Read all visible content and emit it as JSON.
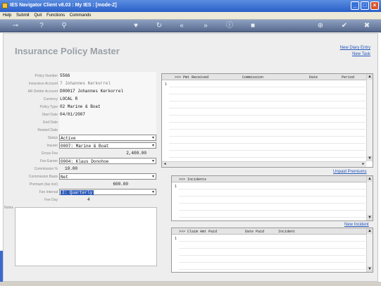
{
  "window": {
    "title": "IES Navigator Client v8.03 : My IES :      [mode-Z]"
  },
  "menu": [
    "Help",
    "Submit",
    "Quit",
    "Functions",
    "Commands"
  ],
  "toolbar_icons": [
    "key-icon",
    "help-icon",
    "search-icon",
    "heart-icon",
    "refresh-icon",
    "rewind-icon",
    "fast-forward-icon",
    "info-icon",
    "stop-icon",
    "add-icon",
    "check-icon",
    "close-icon"
  ],
  "page": {
    "title": "Insurance Policy Master",
    "links": {
      "new_diary": "New Diary Entry",
      "new_task": "New Task"
    }
  },
  "form": {
    "policy_number": {
      "label": "Policy Number",
      "value": "5566"
    },
    "insurance_account": {
      "label": "Insurance Account",
      "value": "7 Johannes Kerkorrel"
    },
    "ar_debtor_account": {
      "label": "AR Debtor Account",
      "value": "D00017 Johannes Kerkorrel"
    },
    "currency": {
      "label": "Currency",
      "value": "LOCAL R"
    },
    "policy_type": {
      "label": "Policy Type",
      "value": "02 Marine & Boat"
    },
    "start_date": {
      "label": "Start Date",
      "value": "04/01/2007"
    },
    "end_date": {
      "label": "End Date",
      "value": ""
    },
    "rewind_date": {
      "label": "Rewind Date",
      "value": ""
    },
    "status": {
      "label": "Status",
      "value": "Active"
    },
    "insurer": {
      "label": "Insurer",
      "value": "0007: Marine & Boat"
    },
    "gross_fee": {
      "label": "Gross Fee",
      "value": "2,400.00"
    },
    "fee_earner": {
      "label": "Fee Earner",
      "value": "0004: Klaus Donohoe"
    },
    "commission_pct": {
      "label": "Commission %",
      "value": "10.00"
    },
    "commission_basis": {
      "label": "Commission Basis",
      "value": "Net"
    },
    "premium": {
      "label": "Premium (tax incl)",
      "value": "600.00"
    },
    "fee_interval": {
      "label": "Fee Interval",
      "value": "2: Quarterly"
    },
    "fee_day": {
      "label": "Fee Day",
      "value": "4"
    },
    "notes": {
      "label": "Notes"
    }
  },
  "grids": {
    "premiums": {
      "columns": [
        ">>> Pmt Received",
        "Commission",
        "Date",
        "Period"
      ],
      "row_number": "1",
      "link": "Unpaid Premiums"
    },
    "incidents": {
      "columns": [
        ">>> Incidents"
      ],
      "row_number": "1",
      "link": "New Incident"
    },
    "claims": {
      "columns": [
        ">>> Claim Amt Paid",
        "Date Paid",
        "Incident"
      ],
      "row_number": "1"
    }
  }
}
